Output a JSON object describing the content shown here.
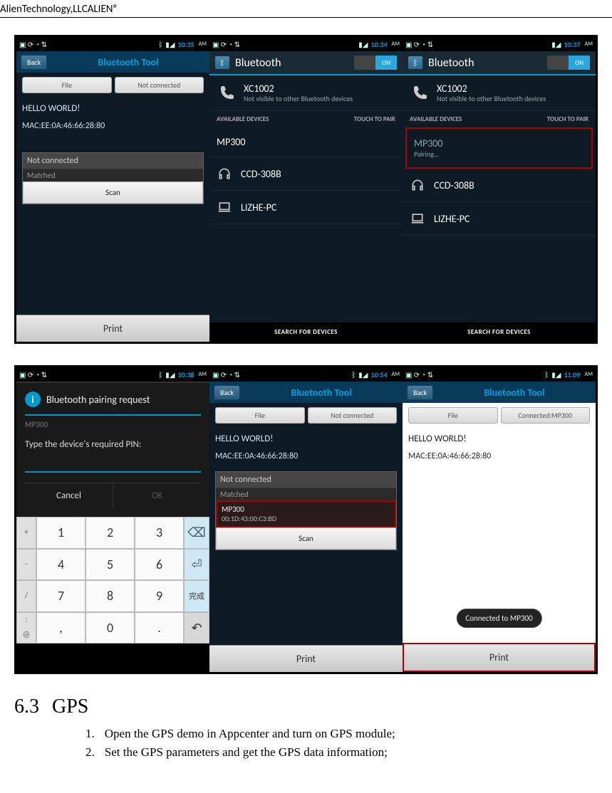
{
  "page_header": "AlienTechnology,LLCALIEN®",
  "shots": {
    "s1": {
      "time": "10:35",
      "am": "AM",
      "back": "Back",
      "title": "Bluetooth Tool",
      "btn_file": "File",
      "btn_conn": "Not connected",
      "hello": "HELLO WORLD!",
      "mac": "MAC:EE:0A:46:66:28:80",
      "popup_status": "Not connected",
      "popup_matched": "Matched",
      "popup_scan": "Scan",
      "print": "Print"
    },
    "s2": {
      "time": "10:34",
      "am": "AM",
      "title": "Bluetooth",
      "toggle_on": "ON",
      "phone_name": "XC1002",
      "phone_sub": "Not visible to other Bluetooth devices",
      "avail": "AVAILABLE DEVICES",
      "touch": "TOUCH TO PAIR",
      "dev1": "MP300",
      "dev2": "CCD-308B",
      "dev3": "LIZHE-PC",
      "search": "SEARCH FOR DEVICES"
    },
    "s3": {
      "time": "10:37",
      "am": "AM",
      "title": "Bluetooth",
      "toggle_on": "ON",
      "phone_name": "XC1002",
      "phone_sub": "Not visible to other Bluetooth devices",
      "avail": "AVAILABLE DEVICES",
      "touch": "TOUCH TO PAIR",
      "dev1": "MP300",
      "dev1_sub": "Pairing…",
      "dev2": "CCD-308B",
      "dev3": "LIZHE-PC",
      "search": "SEARCH FOR DEVICES"
    },
    "s4": {
      "time": "10:38",
      "am": "AM",
      "dialog_title": "Bluetooth pairing request",
      "dialog_body": "Type the device's required PIN:",
      "cancel": "Cancel",
      "ok": "OK",
      "keys_side": [
        "+",
        "-",
        "/",
        ":",
        "@"
      ],
      "keys": [
        "1",
        "2",
        "3",
        "4",
        "5",
        "6",
        "7",
        "8",
        "9",
        ",",
        "0",
        "."
      ],
      "done": "完成"
    },
    "s5": {
      "time": "10:54",
      "am": "AM",
      "back": "Back",
      "title": "Bluetooth Tool",
      "btn_file": "File",
      "btn_conn": "Not connected",
      "hello": "HELLO WORLD!",
      "mac": "MAC:EE:0A:46:66:28:80",
      "popup_status": "Not connected",
      "popup_matched": "Matched",
      "dev_name": "MP300",
      "dev_mac": "00:1D:43:00:C3:BD",
      "popup_scan": "Scan",
      "print": "Print"
    },
    "s6": {
      "time": "11:09",
      "am": "AM",
      "back": "Back",
      "title": "Bluetooth Tool",
      "btn_file": "File",
      "btn_conn": "Connected:MP300",
      "hello": "HELLO WORLD!",
      "mac": "MAC:EE:0A:46:66:28:80",
      "toast": "Connected to MP300",
      "print": "Print"
    }
  },
  "section": {
    "num": "6.3",
    "title": "GPS",
    "items": [
      {
        "n": "1.",
        "t": "Open the GPS demo in Appcenter and turn on GPS module;"
      },
      {
        "n": "2.",
        "t": "Set the GPS parameters and get the GPS data information;"
      }
    ]
  }
}
